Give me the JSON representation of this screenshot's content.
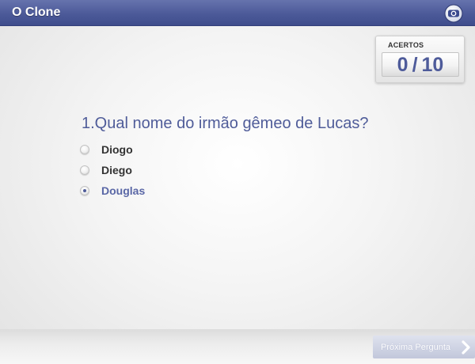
{
  "header": {
    "title": "O Clone",
    "logo_icon": "globo-logo-icon"
  },
  "score": {
    "label": "ACERTOS",
    "correct": "0",
    "separator": "/",
    "total": "10"
  },
  "question": {
    "text": "1.Qual nome do irmão gêmeo de Lucas?",
    "options": [
      {
        "label": "Diogo",
        "selected": false
      },
      {
        "label": "Diego",
        "selected": false
      },
      {
        "label": "Douglas",
        "selected": true
      }
    ]
  },
  "footer": {
    "next_label": "Próxima Pergunta",
    "next_icon": "chevron-right-icon"
  },
  "colors": {
    "header_blue": "#4c5a99",
    "accent_text": "#4f5c99",
    "button_bg": "#c8cde0"
  }
}
